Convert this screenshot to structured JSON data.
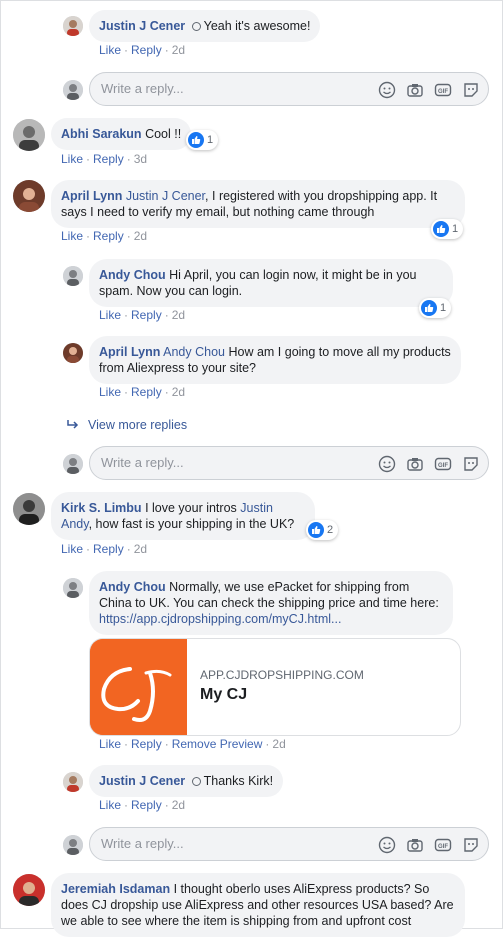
{
  "actions": {
    "like": "Like",
    "reply": "Reply",
    "remove_preview": "Remove Preview",
    "dot": "·"
  },
  "reply_placeholder": "Write a reply...",
  "view_more_replies": "View more replies",
  "comments": [
    {
      "id": "c1",
      "author": "Justin J Cener",
      "verified": true,
      "text": "Yeah it's awesome!",
      "time": "2d"
    },
    {
      "id": "c2",
      "author": "Abhi Sarakun",
      "text": "Cool !!",
      "time": "3d",
      "reactions": "1"
    },
    {
      "id": "c3",
      "author": "April Lynn",
      "mention": "Justin J Cener",
      "text": ", I registered with you dropshipping app. It says I need to verify my email, but nothing came through",
      "time": "2d",
      "reactions": "1"
    },
    {
      "id": "c4",
      "author": "Andy Chou",
      "text": "Hi April, you can login now, it might be in you spam. Now you can login.",
      "time": "2d",
      "reactions": "1"
    },
    {
      "id": "c5",
      "author": "April Lynn",
      "mention": "Andy Chou",
      "text": "How am I going to move all my products from Aliexpress to your site?",
      "time": "2d"
    },
    {
      "id": "c6",
      "author": "Kirk S. Limbu",
      "text_before": "I love your intros",
      "mention": "Justin Andy",
      "text": ", how fast is your shipping in the UK?",
      "time": "2d",
      "reactions": "2"
    },
    {
      "id": "c7",
      "author": "Andy Chou",
      "text": "Normally, we use ePacket for shipping from China to UK. You can check the shipping price and time here:",
      "link": "https://app.cjdropshipping.com/myCJ.html...",
      "time": "2d"
    },
    {
      "id": "c8",
      "author": "Justin J Cener",
      "verified": true,
      "text": "Thanks Kirk!",
      "time": "2d"
    },
    {
      "id": "c9",
      "author": "Jeremiah Isdaman",
      "text": "I thought oberlo uses AliExpress products? So does CJ dropship use AliExpress and other resources USA based? Are we able to see where the item is shipping from and upfront cost"
    }
  ],
  "link_preview": {
    "domain": "APP.CJDROPSHIPPING.COM",
    "title": "My CJ",
    "logo_text": "CJ",
    "logo_color": "#f26522"
  },
  "colors": {
    "name": "#385898",
    "bubble": "#f2f3f5",
    "action": "#4267b2",
    "like": "#1877f2"
  }
}
